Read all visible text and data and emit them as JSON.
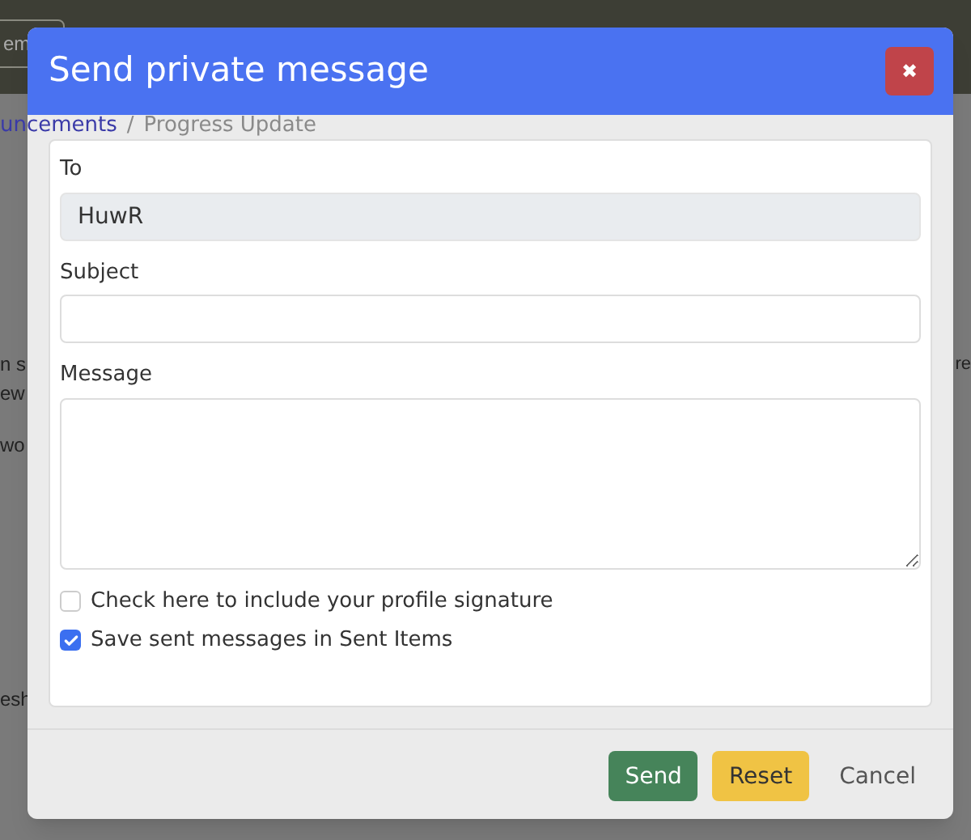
{
  "background": {
    "top_button": "em",
    "breadcrumb": [
      "uncements",
      "/",
      "Progress Update"
    ],
    "fragments_left": [
      "n s",
      "ew",
      "wo"
    ],
    "fragment_right": "re",
    "fragment_bottom": "esh"
  },
  "dialog": {
    "title": "Send private message",
    "close": "✖",
    "fields": [
      {
        "kind": "input",
        "label": "To",
        "value": "HuwR",
        "disabled": true
      },
      {
        "kind": "input",
        "label": "Subject",
        "disabled": false
      },
      {
        "kind": "textarea",
        "label": "Message",
        "disabled": false
      }
    ],
    "options": [
      {
        "label": "Check here to include your profile signature",
        "checked": false
      },
      {
        "label": "Save sent messages in Sent Items",
        "checked": true
      }
    ],
    "buttons": [
      {
        "label": "Send",
        "kind": "success"
      },
      {
        "label": "Reset",
        "kind": "warning"
      },
      {
        "label": "Cancel",
        "kind": "link"
      }
    ]
  }
}
